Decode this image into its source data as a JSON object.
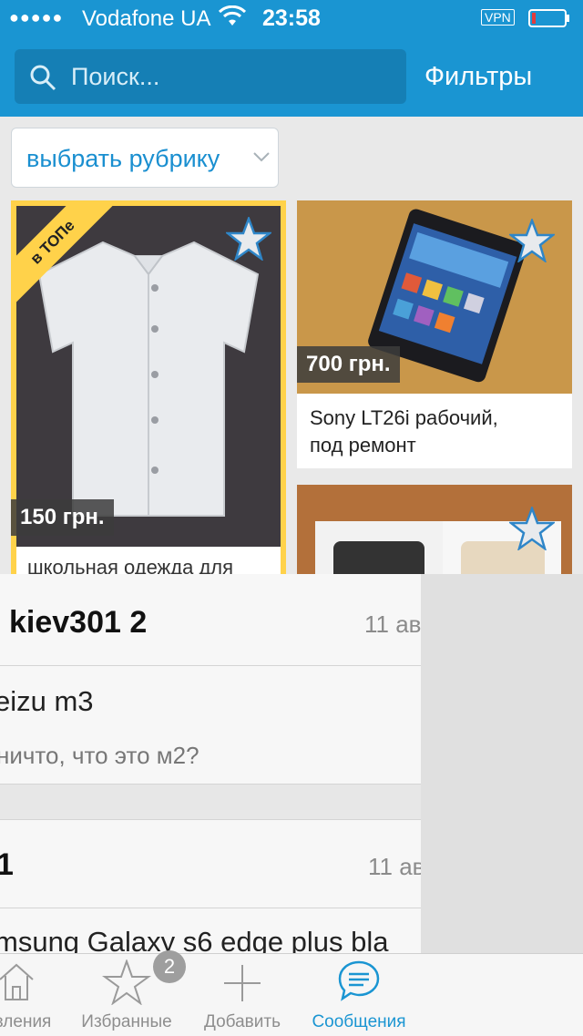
{
  "status_bar": {
    "signal": "●●●●●",
    "carrier": "Vodafone UA",
    "time": "23:58",
    "vpn": "VPN"
  },
  "header": {
    "search_placeholder": "Поиск...",
    "filters_label": "Фильтры"
  },
  "rubric": {
    "label": "выбрать рубрику"
  },
  "listings": [
    {
      "ribbon": "в ТОПе",
      "price": "150 грн.",
      "title": "школьная одежда для"
    },
    {
      "price": "700 грн.",
      "title_line1": "Sony LT26i рабочий,",
      "title_line2": "под ремонт"
    },
    {}
  ],
  "messages": [
    {
      "name": "kiev301 2",
      "date": "11 ав",
      "subject": "eizu m3",
      "text": "ничто, что это м2?"
    },
    {
      "name": "1",
      "date": "11 ав",
      "subject": "msung Galaxy s6 edge plus bla"
    }
  ],
  "tabbar": {
    "tabs": [
      {
        "label": "вления",
        "icon": "home-icon"
      },
      {
        "label": "Избранные",
        "icon": "star-icon",
        "badge": "2"
      },
      {
        "label": "Добавить",
        "icon": "plus-icon"
      },
      {
        "label": "Сообщения",
        "icon": "chat-icon",
        "active": true
      }
    ]
  },
  "colors": {
    "accent": "#1a95d2",
    "top_highlight": "#ffd24a",
    "battery_low": "#e23b3b"
  }
}
